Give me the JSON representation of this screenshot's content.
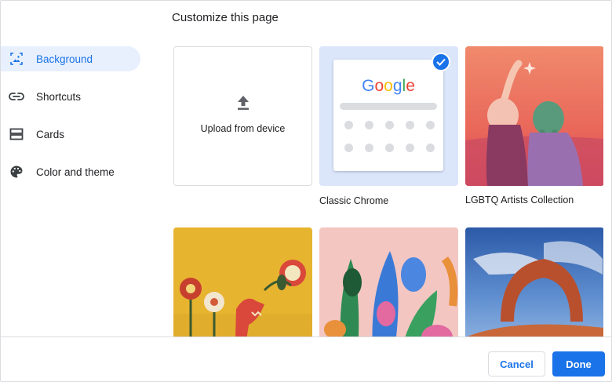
{
  "dialog": {
    "title": "Customize this page"
  },
  "sidebar": {
    "items": [
      {
        "label": "Background",
        "icon": "background-image-icon",
        "active": true
      },
      {
        "label": "Shortcuts",
        "icon": "link-icon",
        "active": false
      },
      {
        "label": "Cards",
        "icon": "cards-icon",
        "active": false
      },
      {
        "label": "Color and theme",
        "icon": "palette-icon",
        "active": false
      }
    ]
  },
  "backgrounds": {
    "upload_label": "Upload from device",
    "classic_label": "Classic Chrome",
    "classic_logo": "Google",
    "classic_selected": true,
    "lgbtq_label": "LGBTQ Artists Collection"
  },
  "footer": {
    "cancel_label": "Cancel",
    "done_label": "Done"
  },
  "colors": {
    "accent": "#1a73e8",
    "active_nav_bg": "#e8f0fe",
    "selected_tile_bg": "#dbe6fb"
  }
}
